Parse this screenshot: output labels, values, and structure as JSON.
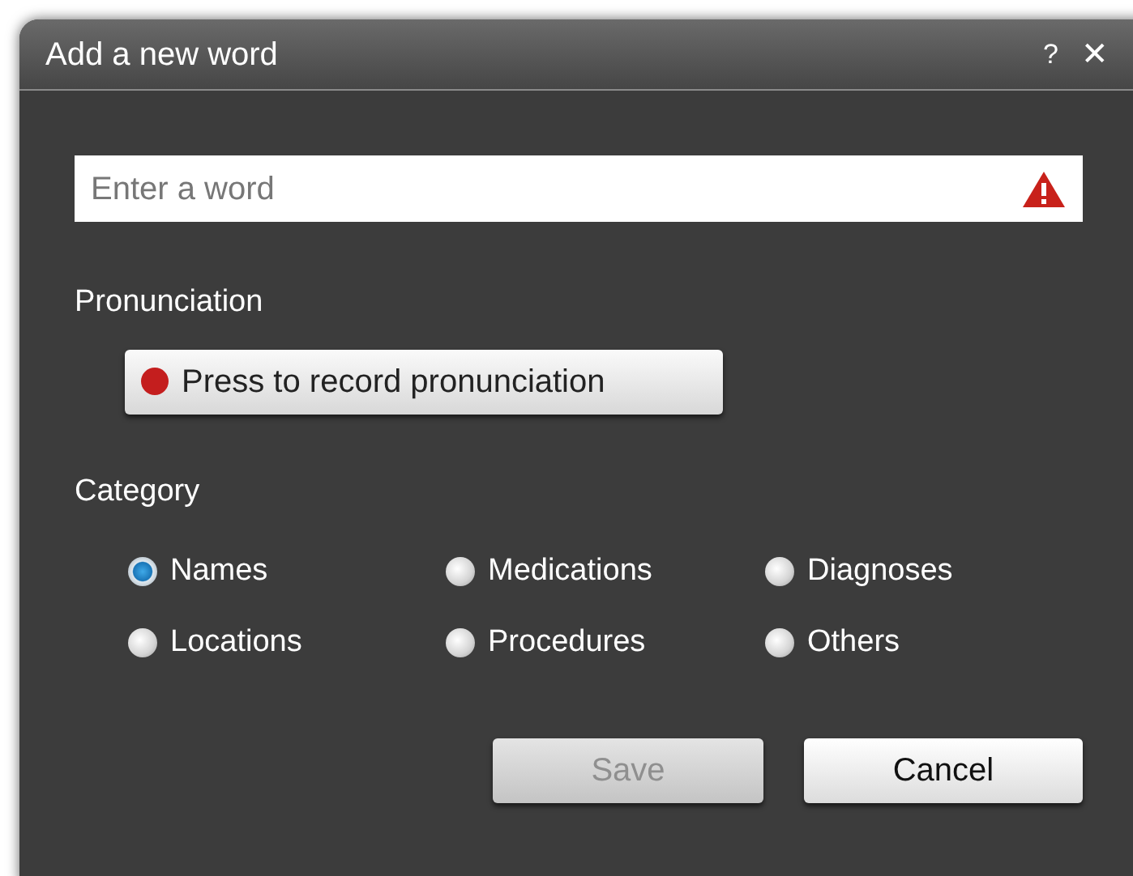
{
  "window": {
    "title": "Add a new word",
    "help": "?",
    "close": "✕"
  },
  "word_field": {
    "placeholder": "Enter a word",
    "warning": true
  },
  "pronunciation": {
    "label": "Pronunciation",
    "record_button": "Press to record pronunciation"
  },
  "category": {
    "label": "Category",
    "options": [
      {
        "label": "Names",
        "selected": true
      },
      {
        "label": "Medications",
        "selected": false
      },
      {
        "label": "Diagnoses",
        "selected": false
      },
      {
        "label": "Locations",
        "selected": false
      },
      {
        "label": "Procedures",
        "selected": false
      },
      {
        "label": "Others",
        "selected": false
      }
    ]
  },
  "buttons": [
    {
      "label": "Save",
      "disabled": true
    },
    {
      "label": "Cancel",
      "disabled": false
    }
  ]
}
